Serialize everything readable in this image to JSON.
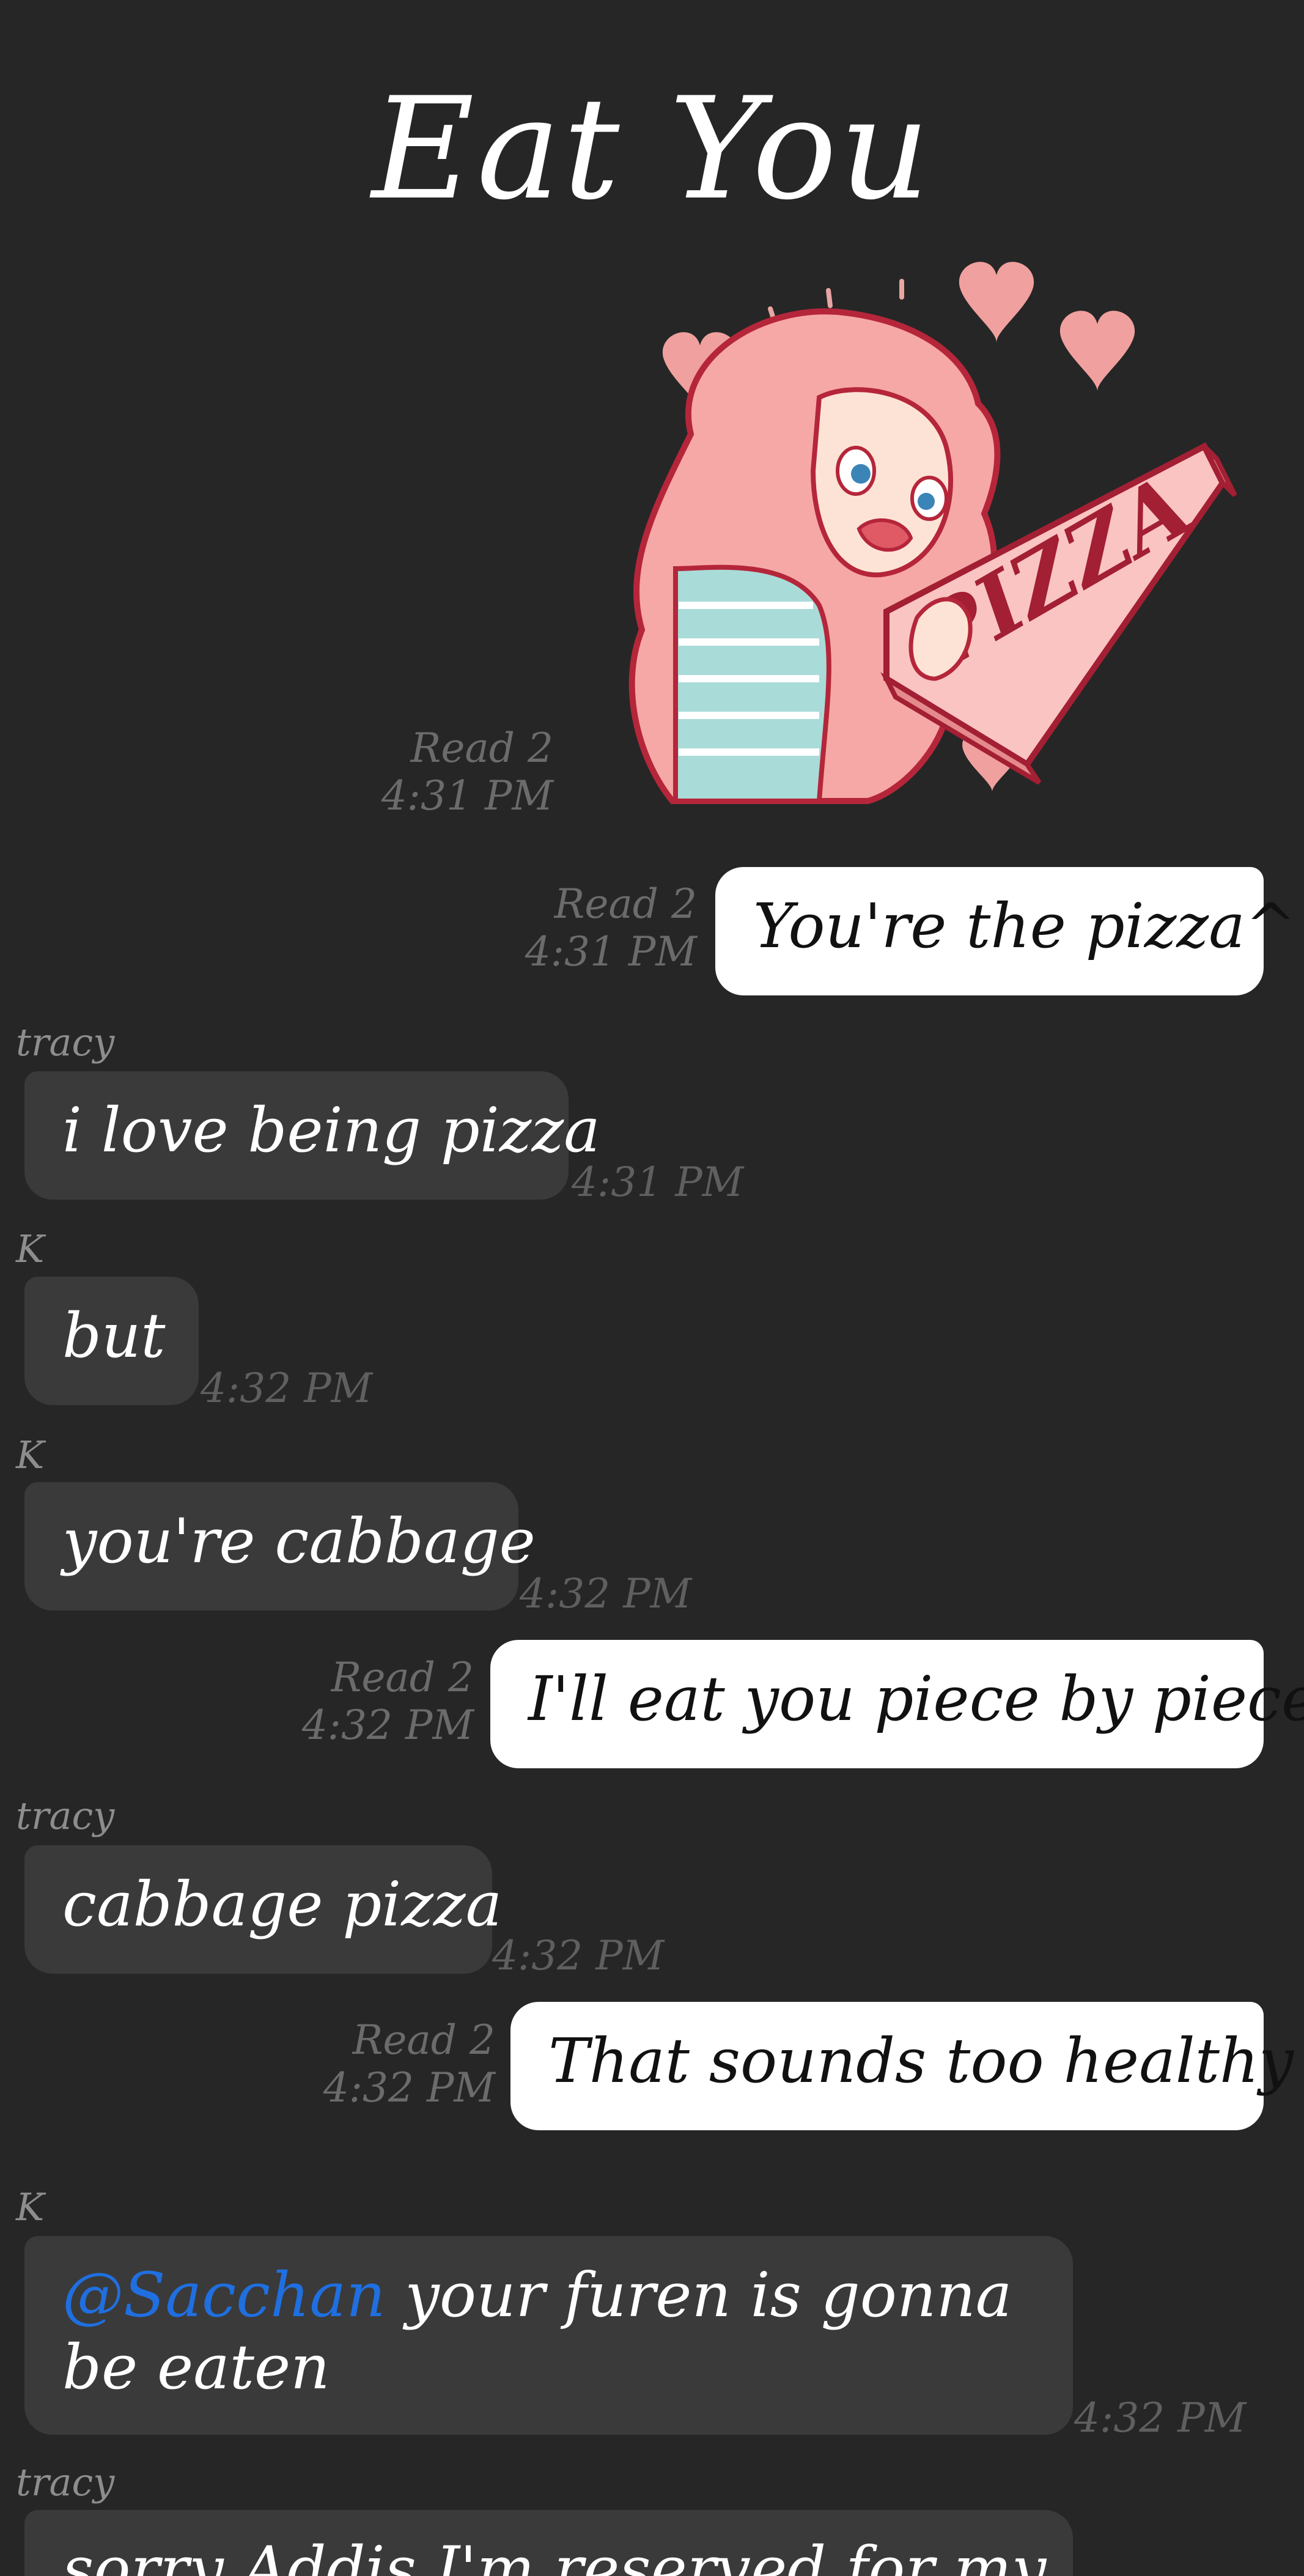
{
  "title": "Eat You",
  "sticker": {
    "label": "PIZZA",
    "icon": "pizza-girl-sticker",
    "read": "Read 2",
    "time": "4:31 PM"
  },
  "messages": [
    {
      "direction": "out",
      "text": "You're the pizza^",
      "read": "Read 2",
      "time": "4:31 PM"
    },
    {
      "direction": "in",
      "sender": "tracy",
      "text": "i love being pizza",
      "time": "4:31 PM"
    },
    {
      "direction": "in",
      "sender": "K",
      "text": "but",
      "time": "4:32 PM"
    },
    {
      "direction": "in",
      "sender": "K",
      "text": "you're cabbage",
      "time": "4:32 PM"
    },
    {
      "direction": "out",
      "text": "I'll eat you piece by piece",
      "read": "Read 2",
      "time": "4:32 PM"
    },
    {
      "direction": "in",
      "sender": "tracy",
      "text": "cabbage pizza",
      "time": "4:32 PM"
    },
    {
      "direction": "out",
      "text": "That sounds too healthy",
      "read": "Read 2",
      "time": "4:32 PM"
    },
    {
      "direction": "in",
      "sender": "K",
      "mention": "@Sacchan",
      "text": " your furen is gonna be eaten",
      "time": "4:32 PM"
    },
    {
      "direction": "in",
      "sender": "tracy",
      "text": "sorry Addis I'm reserved for my"
    }
  ],
  "colors": {
    "background": "#262626",
    "incoming_bubble": "#3a3a3a",
    "outgoing_bubble": "#ffffff",
    "mention": "#1f6fe0",
    "meta_text": "#6b6b6b"
  }
}
